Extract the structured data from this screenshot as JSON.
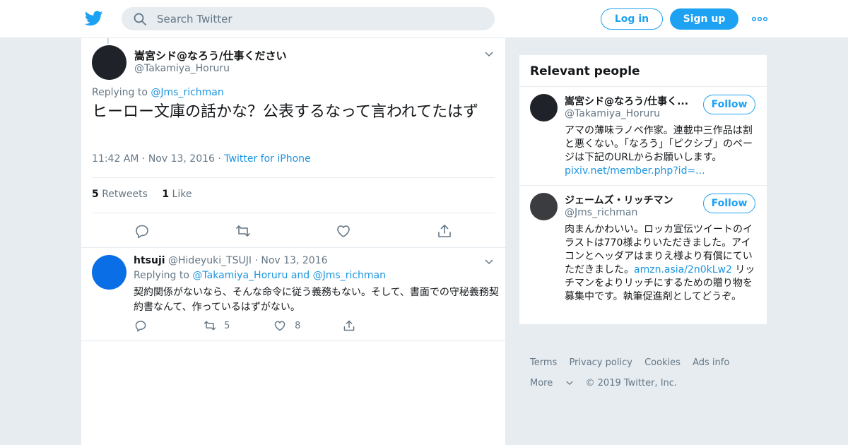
{
  "header": {
    "search_placeholder": "Search Twitter",
    "login_label": "Log in",
    "signup_label": "Sign up"
  },
  "tweet": {
    "author_name": "嵩宮シド@なろう/仕事ください",
    "author_handle": "@Takamiya_Horuru",
    "replying_prefix": "Replying to",
    "replying_to": "@Jms_richman",
    "text": "ヒーロー文庫の話かな？公表するなって言われてたはず",
    "time": "11:42 AM",
    "date": "Nov 13, 2016",
    "source": "Twitter for iPhone",
    "retweet_count": "5",
    "retweet_label": "Retweets",
    "like_count": "1",
    "like_label": "Like"
  },
  "reply": {
    "author_name": "htsuji",
    "author_handle": "@Hideyuki_TSUJI",
    "date": "Nov 13, 2016",
    "replying_prefix": "Replying to",
    "replying_to_1": "@Takamiya_Horuru",
    "replying_and": "and",
    "replying_to_2": "@Jms_richman",
    "text": "契約関係がないなら、そんな命令に従う義務もない。そして、書面での守秘義務契約書なんて、作っているはずがない。",
    "retweet_count": "5",
    "like_count": "8"
  },
  "relevant": {
    "title": "Relevant people",
    "follow_label": "Follow",
    "people": [
      {
        "name": "嵩宮シド@なろう/仕事く...",
        "handle": "@Takamiya_Horuru",
        "bio": "アマの薄味ラノベ作家。連載中三作品は割と悪くない。「なろう」「ピクシブ」のページは下記のURLからお願いします。",
        "link": "pixiv.net/member.php?id=..."
      },
      {
        "name": "ジェームズ・リッチマン",
        "handle": "@Jms_richman",
        "bio": "肉まんかわいい。ロッカ宣伝ツイートのイラストは770様よりいただきました。アイコンとヘッダアはまりえ様より有償にていただきました。",
        "link": "amzn.asia/2n0kLw2",
        "bio_after": "リッチマンをよりリッチにするための贈り物を募集中です。執筆促進剤としてどうぞ。"
      }
    ]
  },
  "footer": {
    "links": [
      "Terms",
      "Privacy policy",
      "Cookies",
      "Ads info"
    ],
    "more": "More",
    "copyright": "© 2019 Twitter, Inc."
  },
  "colors": {
    "accent": "#1da1f2",
    "link": "#1b95e0",
    "page_bg": "#e6ecf0",
    "muted": "#657786"
  },
  "icons": [
    "twitter-bird-icon",
    "search-icon",
    "more-dots-icon",
    "chevron-down-icon",
    "reply-icon",
    "retweet-icon",
    "like-icon",
    "share-icon"
  ]
}
